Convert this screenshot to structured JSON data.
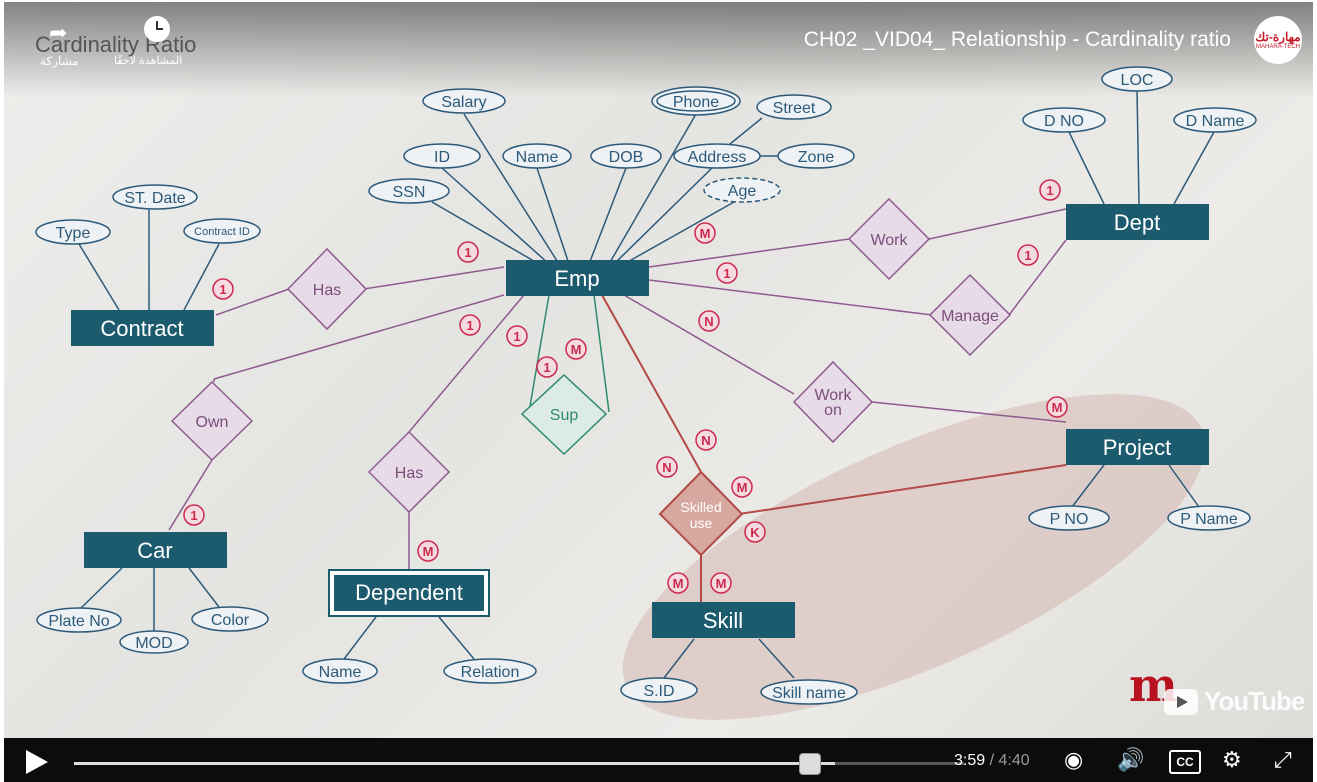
{
  "video": {
    "title": "CH02 _VID04_ Relationship - Cardinality ratio",
    "overlay_title": "Cardinality Ratio",
    "share_label": "مشاركة",
    "watch_later_label": "المشاهدة لاحقًا",
    "channel_logo": {
      "arabic": "مهارة-تك",
      "sub": "MAHARA-TECH"
    },
    "youtube_label": "YouTube",
    "mooc_mark": "m"
  },
  "player": {
    "current_time": "3:59",
    "duration": "4:40",
    "time_separator": " / ",
    "progress": 0.855
  },
  "diagram": {
    "entities": {
      "emp": "Emp",
      "dept": "Dept",
      "contract": "Contract",
      "car": "Car",
      "dependent": "Dependent",
      "skill": "Skill",
      "project": "Project"
    },
    "relationships": {
      "has_contract": "Has",
      "work": "Work",
      "manage": "Manage",
      "own": "Own",
      "has_dependent": "Has",
      "sup": "Sup",
      "work_on_1": "Work",
      "work_on_2": "on",
      "skilled_use_1": "Skilled",
      "skilled_use_2": "use"
    },
    "attributes": {
      "salary": "Salary",
      "phone": "Phone",
      "street": "Street",
      "id": "ID",
      "name": "Name",
      "dob": "DOB",
      "address": "Address",
      "zone": "Zone",
      "ssn": "SSN",
      "age": "Age",
      "st_date": "ST. Date",
      "type": "Type",
      "contract_id": "Contract ID",
      "loc": "LOC",
      "d_no": "D NO",
      "d_name": "D Name",
      "p_no": "P NO",
      "p_name": "P Name",
      "plate_no": "Plate No",
      "mod": "MOD",
      "color": "Color",
      "dep_name": "Name",
      "relation": "Relation",
      "s_id": "S.ID",
      "skill_name": "Skill name"
    },
    "cardinalities": {
      "emp_has": "1",
      "contract_has": "1",
      "emp_work": "M",
      "dept_work": "1",
      "emp_manage": "1",
      "dept_manage": "1",
      "emp_own": "1",
      "car_own": "1",
      "emp_has_dep": "1",
      "dep_has": "M",
      "sup_1": "1",
      "sup_m": "M",
      "emp_workon": "N",
      "project_workon": "M",
      "emp_skilled": "N",
      "skilled_n": "N",
      "skilled_m": "M",
      "skilled_k": "K",
      "skill_m1": "M",
      "skill_m2": "M"
    },
    "colors": {
      "entity": "#1c5b6d",
      "attribute": "#2d5a7a",
      "relationship": "#8d5b8e",
      "sup": "#2e8b6f",
      "highlight": "#b24a46",
      "cardinality": "#cc2a4f"
    }
  }
}
